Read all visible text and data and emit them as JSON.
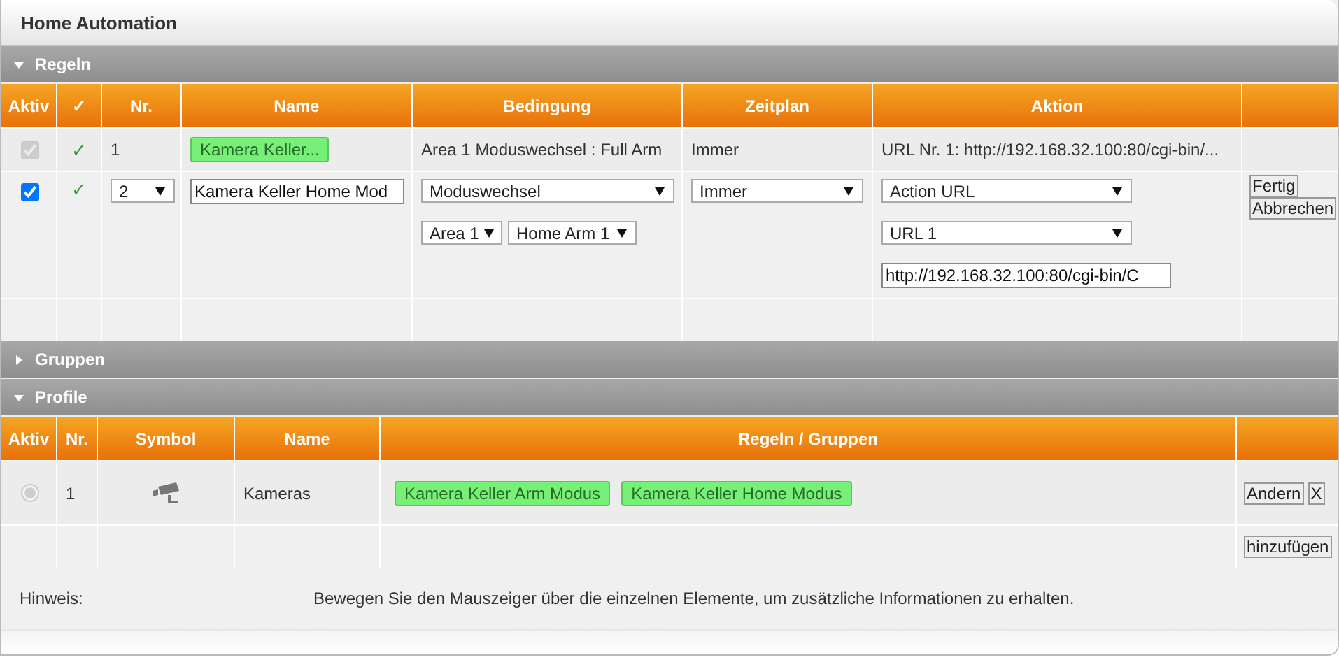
{
  "title": "Home Automation",
  "sections": [
    {
      "kind": "rules",
      "title": "Regeln",
      "expanded": true,
      "columns": [
        "Aktiv",
        "✓",
        "Nr.",
        "Name",
        "Bedingung",
        "Zeitplan",
        "Aktion"
      ],
      "rows": [
        {
          "kind": "view",
          "active": {
            "checked": true,
            "disabled": true
          },
          "valid": "✓",
          "nr": "1",
          "name": "Kamera Keller...",
          "condition": "Area 1 Moduswechsel : Full Arm",
          "schedule": "Immer",
          "action": "URL Nr. 1: http://192.168.32.100:80/cgi-bin/..."
        },
        {
          "kind": "edit",
          "active": {
            "checked": true,
            "disabled": false
          },
          "valid": "✓",
          "nr": "2",
          "name": "Kamera Keller Home Mod",
          "condition": "Moduswechsel",
          "condition_area": "Area 1",
          "condition_mode": "Home Arm 1",
          "schedule": "Immer",
          "action": "Action URL",
          "action_url": "URL 1",
          "action_address": "http://192.168.32.100:80/cgi-bin/C",
          "buttons": [
            "Fertig",
            "Abbrechen"
          ]
        },
        {
          "kind": "empty"
        }
      ]
    },
    {
      "title": "Gruppen",
      "expanded": false
    },
    {
      "kind": "profiles",
      "title": "Profile",
      "expanded": true,
      "columns": [
        "Aktiv",
        "Nr.",
        "Symbol",
        "Name",
        "Regeln / Gruppen"
      ],
      "rows": [
        {
          "kind": "view",
          "active": {
            "selected": true,
            "disabled": true
          },
          "nr": "1",
          "name": "Kameras",
          "members": [
            "Kamera Keller Arm Modus",
            "Kamera Keller Home Modus"
          ],
          "buttons": [
            "Andern",
            "X"
          ]
        },
        {
          "kind": "add",
          "buttons": [
            "hinzufügen"
          ]
        }
      ]
    }
  ],
  "hint": {
    "label": "Hinweis:",
    "text": "Bewegen Sie den Mauszeiger über die einzelnen Elemente, um zusätzliche Informationen zu erhalten."
  }
}
